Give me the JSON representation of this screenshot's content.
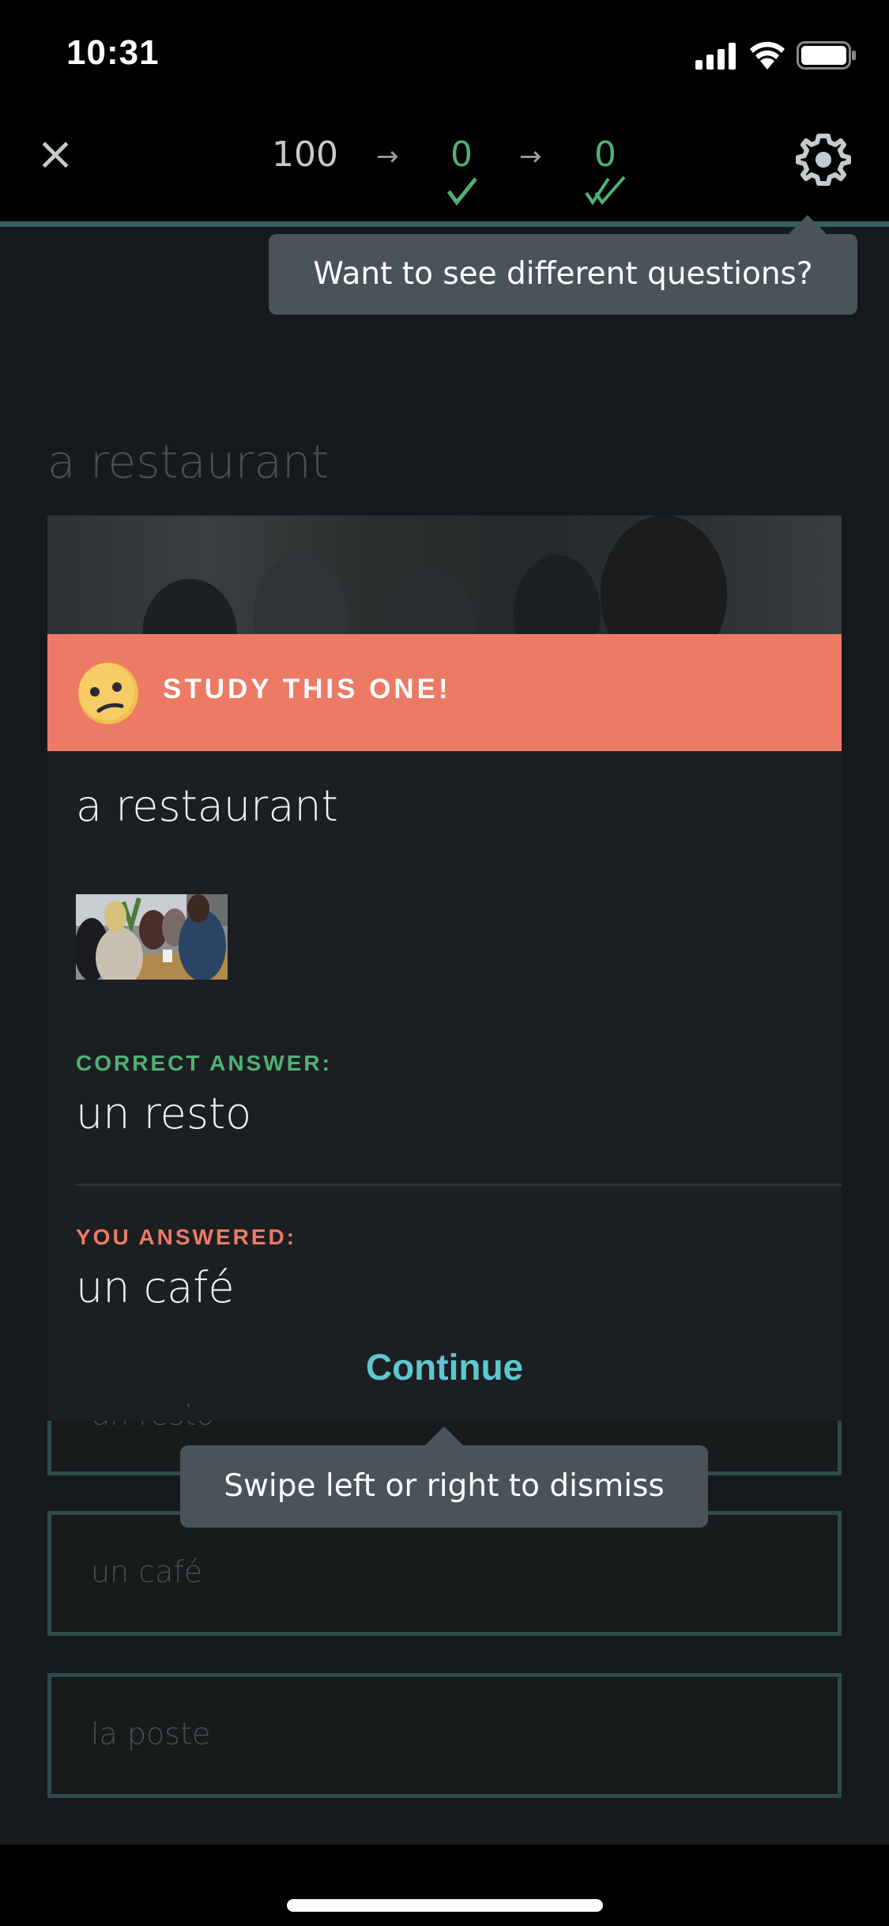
{
  "status_bar": {
    "time": "10:31",
    "signal_icon": "cellular-signal-icon",
    "wifi_icon": "wifi-icon",
    "battery_icon": "battery-icon"
  },
  "navbar": {
    "close_icon": "close-icon",
    "close_glyph": "×",
    "progress": [
      {
        "value": "100",
        "state": "remaining"
      },
      {
        "value": "0",
        "state": "correct-once",
        "icon": "check-icon"
      },
      {
        "value": "0",
        "state": "mastered",
        "icon": "double-check-icon"
      }
    ],
    "arrow_glyph": "→",
    "settings_icon": "gear-icon"
  },
  "tooltips": {
    "settings_hint": "Want to see different questions?",
    "dismiss_hint": "Swipe left or right to dismiss"
  },
  "question": {
    "prompt": "a restaurant"
  },
  "feedback_card": {
    "banner_text": "STUDY THIS ONE!",
    "banner_icon": "confused-face-emoji",
    "term": "a restaurant",
    "image_alt": "restaurant-photo",
    "correct_label": "CORRECT ANSWER:",
    "correct_answer": "un resto",
    "user_label": "YOU ANSWERED:",
    "user_answer": "un café",
    "continue_label": "Continue"
  },
  "options": [
    {
      "label": "un resto"
    },
    {
      "label": "un café"
    },
    {
      "label": "la poste"
    }
  ],
  "colors": {
    "accent_teal": "#5ec7cc",
    "correct_green": "#4fb175",
    "incorrect_coral": "#ed7a65",
    "tooltip_bg": "#48545a",
    "progress_line": "#355f63"
  }
}
